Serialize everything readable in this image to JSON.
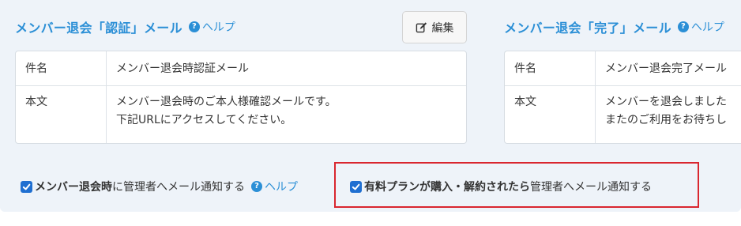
{
  "left": {
    "title": "メンバー退会「認証」メール",
    "help_label": "ヘルプ",
    "edit_label": "編集",
    "subject_label": "件名",
    "subject_value": "メンバー退会時認証メール",
    "body_label": "本文",
    "body_line1": "メンバー退会時のご本人様確認メールです。",
    "body_line2": "下記URLにアクセスしてください。"
  },
  "right": {
    "title": "メンバー退会「完了」メール",
    "help_label": "ヘルプ",
    "subject_label": "件名",
    "subject_value": "メンバー退会完了メール",
    "body_label": "本文",
    "body_line1": "メンバーを退会しました",
    "body_line2": "またのご利用をお待ちし"
  },
  "notify": {
    "withdraw_strong": "メンバー退会時",
    "withdraw_rest": "に管理者へメール通知する",
    "withdraw_help": "ヘルプ",
    "withdraw_checked": true,
    "plan_strong": "有料プランが購入・解約されたら",
    "plan_rest": "管理者へメール通知する",
    "plan_checked": true
  },
  "colors": {
    "accent": "#2b8fd6",
    "checkbox": "#1f6fd1",
    "highlight": "#d9262f",
    "panel_bg": "#eef3f9"
  }
}
